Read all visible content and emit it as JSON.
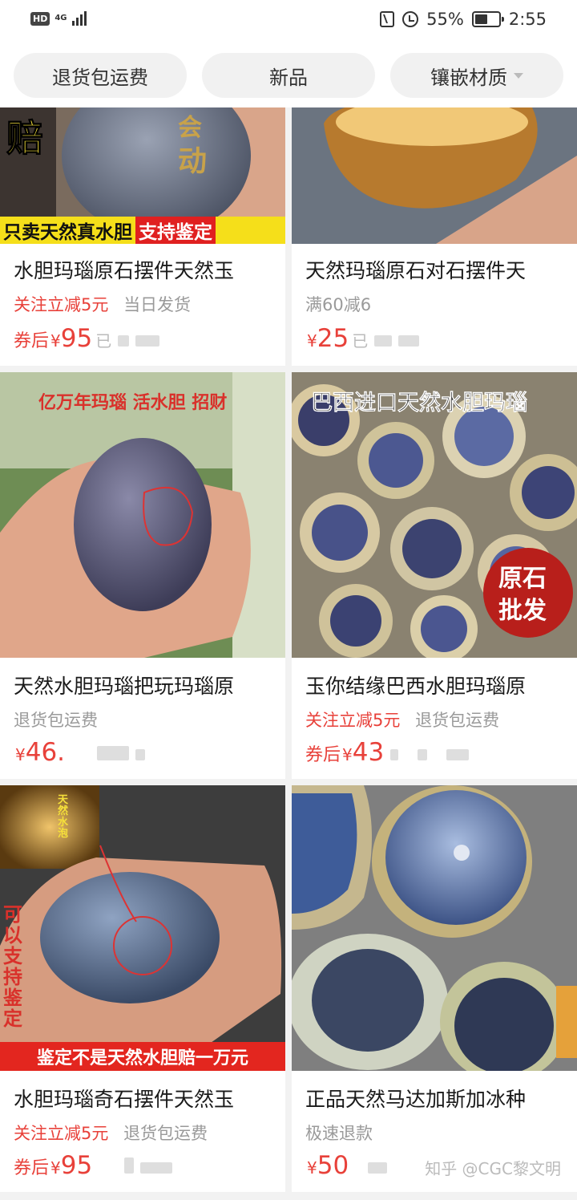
{
  "status_bar": {
    "hd": "HD",
    "network": "4G",
    "battery_percent": "55%",
    "battery_level": 0.55,
    "time": "2:55",
    "icons": [
      "nfc-icon",
      "alarm-icon",
      "battery-icon",
      "signal-icon"
    ]
  },
  "filters": [
    {
      "label": "退货包运费",
      "has_dropdown": false
    },
    {
      "label": "新品",
      "has_dropdown": false
    },
    {
      "label": "镶嵌材质",
      "has_dropdown": true
    }
  ],
  "products": [
    {
      "title": "水胆玛瑙原石摆件天然玉",
      "tags": [
        {
          "text": "关注立减5元",
          "style": "red"
        },
        {
          "text": "当日发货",
          "style": "grey"
        }
      ],
      "price_prefix": "券后",
      "price": "95",
      "price_tail": "已",
      "image_texts": [
        "赔",
        "会",
        "动"
      ],
      "image_banner": {
        "plain": "只卖天然真水胆",
        "highlight": "支持鉴定"
      }
    },
    {
      "title": "天然玛瑙原石对石摆件天",
      "tags": [
        {
          "text": "满60减6",
          "style": "grey"
        }
      ],
      "price_prefix": "",
      "price": "25",
      "price_tail": "已"
    },
    {
      "title": "天然水胆玛瑙把玩玛瑙原",
      "tags": [
        {
          "text": "退货包运费",
          "style": "grey"
        }
      ],
      "price_prefix": "",
      "price": "46.",
      "price_tail": "",
      "image_texts": [
        "亿万年玛瑙 活水胆 招财"
      ]
    },
    {
      "title": "玉你结缘巴西水胆玛瑙原",
      "tags": [
        {
          "text": "关注立减5元",
          "style": "red"
        },
        {
          "text": "退货包运费",
          "style": "grey"
        }
      ],
      "price_prefix": "券后",
      "price": "43",
      "price_tail": "",
      "image_texts": [
        "巴西进口天然水胆玛瑙",
        "原石",
        "批发"
      ]
    },
    {
      "title": "水胆玛瑙奇石摆件天然玉",
      "tags": [
        {
          "text": "关注立减5元",
          "style": "red"
        },
        {
          "text": "退货包运费",
          "style": "grey"
        }
      ],
      "price_prefix": "券后",
      "price": "95",
      "price_tail": "",
      "image_texts": [
        "天然水泡",
        "可以支持鉴定"
      ],
      "image_banner_red": "鉴定不是天然水胆赔一万元"
    },
    {
      "title": "正品天然马达加斯加冰种",
      "tags": [
        {
          "text": "极速退款",
          "style": "grey"
        }
      ],
      "price_prefix": "",
      "price": "50",
      "price_tail": ""
    }
  ],
  "watermark": "知乎 @CGC黎文明",
  "colors": {
    "accent_red": "#e8413a",
    "grey_text": "#9a9a9a"
  }
}
